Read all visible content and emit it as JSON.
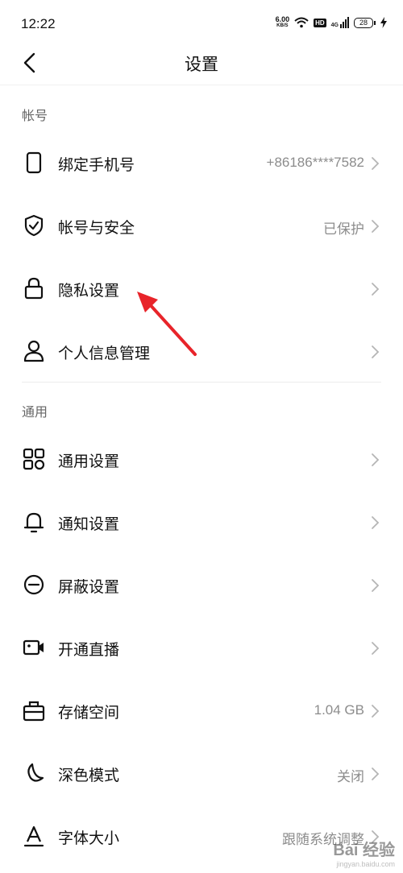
{
  "status_bar": {
    "time": "12:22",
    "net_speed_value": "6.00",
    "net_speed_unit": "KB/S",
    "hd_label": "HD",
    "network_label": "4G",
    "battery_level": "28"
  },
  "nav": {
    "title": "设置"
  },
  "sections": {
    "account": {
      "header": "帐号"
    },
    "general": {
      "header": "通用"
    }
  },
  "rows": {
    "bind_phone": {
      "label": "绑定手机号",
      "value": "+86186****7582"
    },
    "account_security": {
      "label": "帐号与安全",
      "value": "已保护"
    },
    "privacy": {
      "label": "隐私设置"
    },
    "personal_info": {
      "label": "个人信息管理"
    },
    "general_settings": {
      "label": "通用设置"
    },
    "notification": {
      "label": "通知设置"
    },
    "block": {
      "label": "屏蔽设置"
    },
    "live": {
      "label": "开通直播"
    },
    "storage": {
      "label": "存储空间",
      "value": "1.04 GB"
    },
    "dark_mode": {
      "label": "深色模式",
      "value": "关闭"
    },
    "font_size": {
      "label": "字体大小",
      "value": "跟随系统调整"
    }
  },
  "icons": {
    "back": "chevron-left-icon",
    "phone": "phone-icon",
    "shield": "shield-check-icon",
    "lock": "lock-icon",
    "person": "person-icon",
    "grid": "grid-icon",
    "bell": "bell-icon",
    "block": "minus-circle-icon",
    "video": "video-camera-icon",
    "storage": "toolbox-icon",
    "moon": "moon-icon",
    "font": "font-a-icon"
  },
  "colors": {
    "annotation_arrow": "#e8242a",
    "value_text": "#8c8c8c",
    "section_header": "#666666"
  },
  "watermark": {
    "logo": "Bai 经验",
    "url": "jingyan.baidu.com"
  }
}
